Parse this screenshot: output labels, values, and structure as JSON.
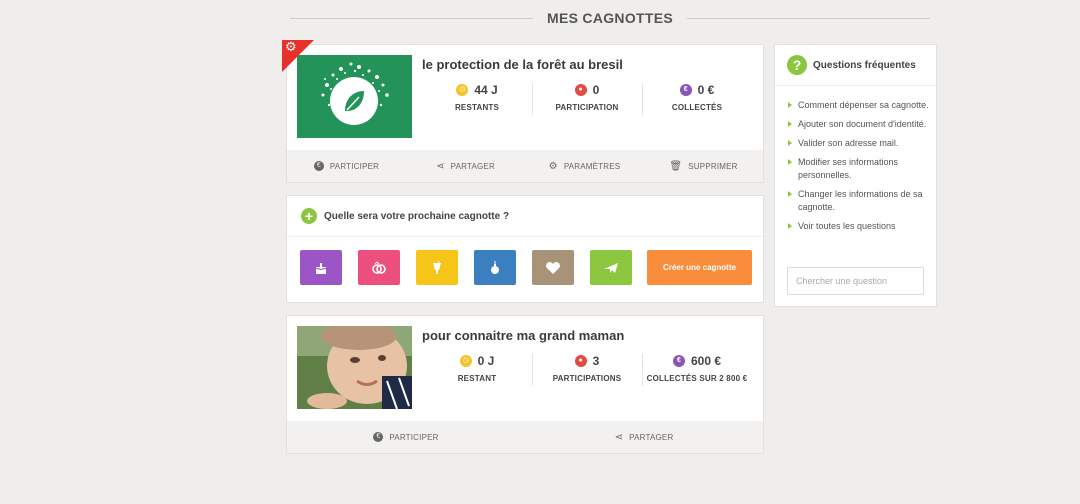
{
  "page": {
    "title": "MES CAGNOTTES"
  },
  "pots": [
    {
      "title": "le protection de la forêt au bresil",
      "stats": [
        {
          "value": "44 J",
          "label": "RESTANTS",
          "icon": "clock-icon",
          "color": "#f3c428"
        },
        {
          "value": "0",
          "label": "PARTICIPATION",
          "icon": "user-icon",
          "color": "#e04b43"
        },
        {
          "value": "0 €",
          "label": "COLLECTÉS",
          "icon": "euro-icon",
          "color": "#8a55b9"
        }
      ],
      "actions": [
        {
          "label": "PARTICIPER",
          "icon": "participate-icon"
        },
        {
          "label": "PARTAGER",
          "icon": "share-icon"
        },
        {
          "label": "PARAMÈTRES",
          "icon": "gear-icon"
        },
        {
          "label": "SUPPRIMER",
          "icon": "trash-icon"
        }
      ]
    },
    {
      "title": "pour connaitre ma grand maman",
      "stats": [
        {
          "value": "0 J",
          "label": "RESTANT",
          "icon": "clock-icon",
          "color": "#f3c428"
        },
        {
          "value": "3",
          "label": "PARTICIPATIONS",
          "icon": "user-icon",
          "color": "#e04b43"
        },
        {
          "value": "600 €",
          "label": "COLLECTÉS SUR 2 800 €",
          "icon": "euro-icon",
          "color": "#8a55b9"
        }
      ],
      "actions": [
        {
          "label": "PARTICIPER",
          "icon": "participate-icon"
        },
        {
          "label": "PARTAGER",
          "icon": "share-icon"
        }
      ]
    }
  ],
  "next": {
    "question": "Quelle sera votre prochaine cagnotte ?",
    "categories": [
      {
        "icon": "cake-icon",
        "color": "#9b55c6"
      },
      {
        "icon": "rings-icon",
        "color": "#ec4f7d"
      },
      {
        "icon": "drink-icon",
        "color": "#f5c518"
      },
      {
        "icon": "ornament-icon",
        "color": "#3b7fc1"
      },
      {
        "icon": "heart-icon",
        "color": "#a89379"
      },
      {
        "icon": "plane-icon",
        "color": "#8dc63f"
      }
    ],
    "create_label": "Créer une cagnotte",
    "create_color": "#f98d3c"
  },
  "faq": {
    "title": "Questions fréquentes",
    "items": [
      "Comment dépenser sa cagnotte.",
      "Ajouter son document d'identité.",
      "Valider son adresse mail.",
      "Modifier ses informations personnelles.",
      "Changer les informations de sa cagnotte.",
      "Voir toutes les questions"
    ],
    "search_placeholder": "Chercher une question"
  }
}
